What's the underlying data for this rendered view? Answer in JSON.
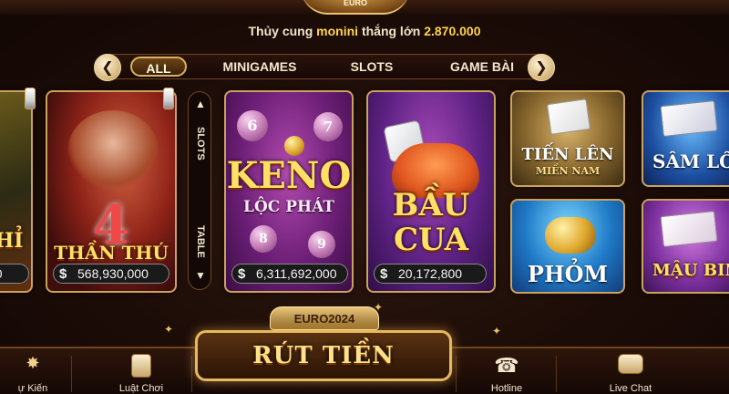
{
  "top": {
    "medallion_text": "EURO"
  },
  "notice": {
    "prefix": "Thủy cung",
    "user": "monini",
    "middle": "thắng lớn",
    "amount": "2.870.000"
  },
  "tabs": {
    "prev_icon": "chevron-left-icon",
    "next_icon": "chevron-right-icon",
    "items": [
      {
        "label": "ALL",
        "active": true
      },
      {
        "label": "MINIGAMES",
        "active": false
      },
      {
        "label": "SLOTS",
        "active": false
      },
      {
        "label": "GAME BÀI",
        "active": false
      }
    ]
  },
  "filter": {
    "up_icon": "triangle-up-icon",
    "down_icon": "triangle-down-icon",
    "top_label": "SLOTS",
    "bottom_label": "TABLE"
  },
  "games": {
    "left_partial": {
      "title": "HỈ",
      "jackpot": "00"
    },
    "than_thu": {
      "number": "4",
      "title": "THẦN THÚ",
      "jackpot": "568,930,000",
      "currency": "$"
    },
    "keno": {
      "title": "KENO",
      "subtitle": "LỘC PHÁT",
      "jackpot": "6,311,692,000",
      "currency": "$",
      "balls": [
        "6",
        "7",
        "8",
        "9"
      ]
    },
    "bau_cua": {
      "title1": "BẦU",
      "title2": "CUA",
      "jackpot": "20,172,800",
      "currency": "$"
    },
    "tien_len": {
      "title": "TIẾN LÊN",
      "subtitle": "MIỀN NAM"
    },
    "phom": {
      "title": "PHỎM"
    },
    "sam_loc": {
      "title": "SÂM LỐ"
    },
    "mau_binh": {
      "title": "MẬU BIN"
    }
  },
  "euro_badge": "EURO2024",
  "withdraw": {
    "label": "RÚT TIỀN"
  },
  "bottom": {
    "items": [
      {
        "label": "ự Kiến",
        "icon": "party-popper-icon"
      },
      {
        "label": "Luật Chơi",
        "icon": "rulebook-icon"
      },
      {
        "label": "Hotline",
        "icon": "telephone-icon"
      },
      {
        "label": "Live Chat",
        "icon": "chat-bubbles-icon"
      }
    ]
  },
  "colors": {
    "accent_gold": "#ffd54a",
    "frame_gold": "#caa25a",
    "background": "#1b0d08"
  }
}
